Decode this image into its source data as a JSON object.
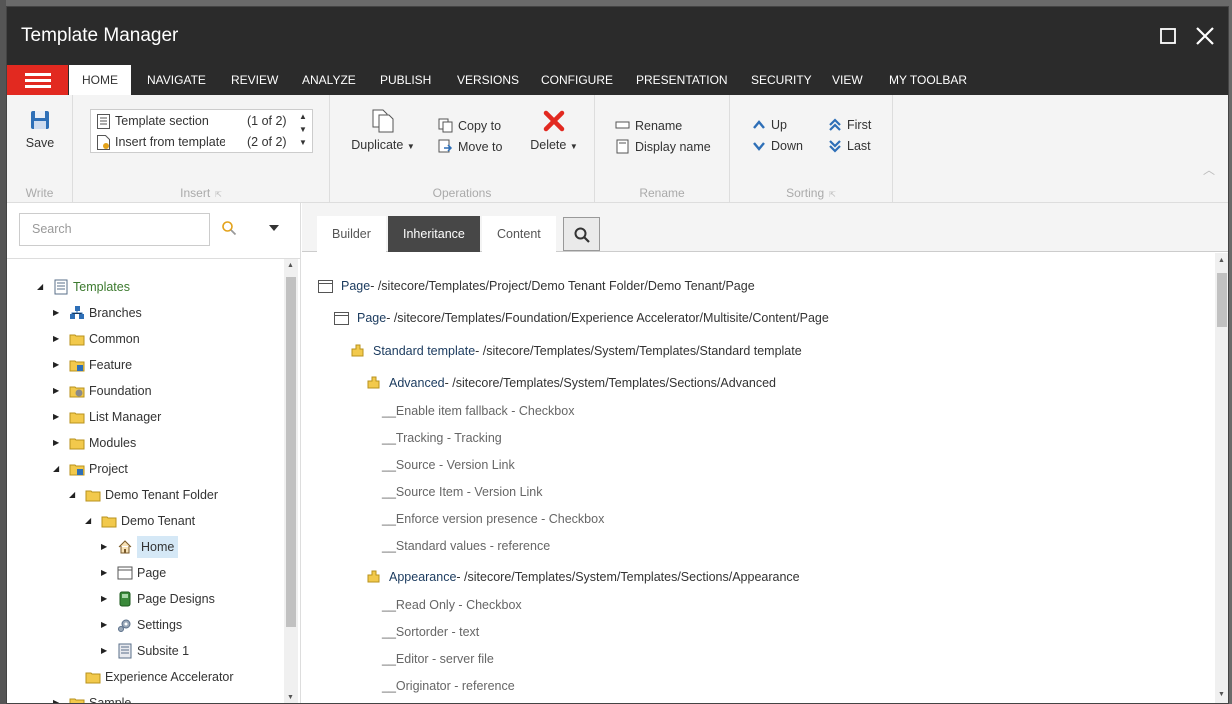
{
  "window": {
    "title": "Template Manager"
  },
  "menu": {
    "tabs": [
      {
        "label": "HOME"
      },
      {
        "label": "NAVIGATE"
      },
      {
        "label": "REVIEW"
      },
      {
        "label": "ANALYZE"
      },
      {
        "label": "PUBLISH"
      },
      {
        "label": "VERSIONS"
      },
      {
        "label": "CONFIGURE"
      },
      {
        "label": "PRESENTATION"
      },
      {
        "label": "SECURITY"
      },
      {
        "label": "VIEW"
      },
      {
        "label": "MY TOOLBAR"
      }
    ],
    "active": "HOME"
  },
  "ribbon": {
    "write": {
      "label": "Write",
      "save": "Save"
    },
    "insert": {
      "label": "Insert",
      "items": [
        {
          "text": "Template section",
          "count": "(1 of 2)"
        },
        {
          "text": "Insert from template",
          "count": "(2 of 2)"
        }
      ]
    },
    "operations": {
      "label": "Operations",
      "duplicate": "Duplicate",
      "copy_to": "Copy to",
      "move_to": "Move to",
      "delete": "Delete"
    },
    "rename": {
      "label": "Rename",
      "rename": "Rename",
      "display_name": "Display name"
    },
    "sorting": {
      "label": "Sorting",
      "up": "Up",
      "down": "Down",
      "first": "First",
      "last": "Last"
    }
  },
  "search": {
    "placeholder": "Search"
  },
  "tree": [
    {
      "label": "Templates",
      "icon": "templates-icon"
    },
    {
      "label": "Branches",
      "icon": "branches-icon"
    },
    {
      "label": "Common",
      "icon": "folder-icon"
    },
    {
      "label": "Feature",
      "icon": "feature-folder-icon"
    },
    {
      "label": "Foundation",
      "icon": "foundation-folder-icon"
    },
    {
      "label": "List Manager",
      "icon": "folder-icon"
    },
    {
      "label": "Modules",
      "icon": "folder-icon"
    },
    {
      "label": "Project",
      "icon": "project-folder-icon"
    },
    {
      "label": "Demo Tenant Folder",
      "icon": "folder-icon"
    },
    {
      "label": "Demo Tenant",
      "icon": "folder-icon"
    },
    {
      "label": "Home",
      "icon": "home-icon"
    },
    {
      "label": "Page",
      "icon": "page-template-icon"
    },
    {
      "label": "Page Designs",
      "icon": "page-designs-icon"
    },
    {
      "label": "Settings",
      "icon": "settings-icon"
    },
    {
      "label": "Subsite 1",
      "icon": "subsite-icon"
    },
    {
      "label": "Experience Accelerator",
      "icon": "folder-icon"
    },
    {
      "label": "Sample",
      "icon": "folder-icon"
    }
  ],
  "tabs": [
    {
      "label": "Builder"
    },
    {
      "label": "Inheritance"
    },
    {
      "label": "Content"
    }
  ],
  "inheritance": {
    "templates": [
      {
        "name": "Page",
        "path": " - /sitecore/Templates/Project/Demo Tenant Folder/Demo Tenant/Page"
      },
      {
        "name": "Page",
        "path": " - /sitecore/Templates/Foundation/Experience Accelerator/Multisite/Content/Page"
      },
      {
        "name": "Standard template",
        "path": " - /sitecore/Templates/System/Templates/Standard template"
      }
    ],
    "sections": [
      {
        "name": "Advanced",
        "path": " - /sitecore/Templates/System/Templates/Sections/Advanced",
        "fields": [
          "__Enable item fallback - Checkbox",
          "__Tracking - Tracking",
          "__Source - Version Link",
          "__Source Item - Version Link",
          "__Enforce version presence - Checkbox",
          "__Standard values - reference"
        ]
      },
      {
        "name": "Appearance",
        "path": " - /sitecore/Templates/System/Templates/Sections/Appearance",
        "fields": [
          "__Read Only - Checkbox",
          "__Sortorder - text",
          "__Editor - server file",
          "__Originator - reference"
        ]
      }
    ]
  },
  "colors": {
    "titlebar": "#2b2b2b",
    "menu_accent": "#e22920",
    "active_tab": "#474747",
    "selection": "#d5e8f6",
    "tree_root": "#3c7a2e"
  }
}
